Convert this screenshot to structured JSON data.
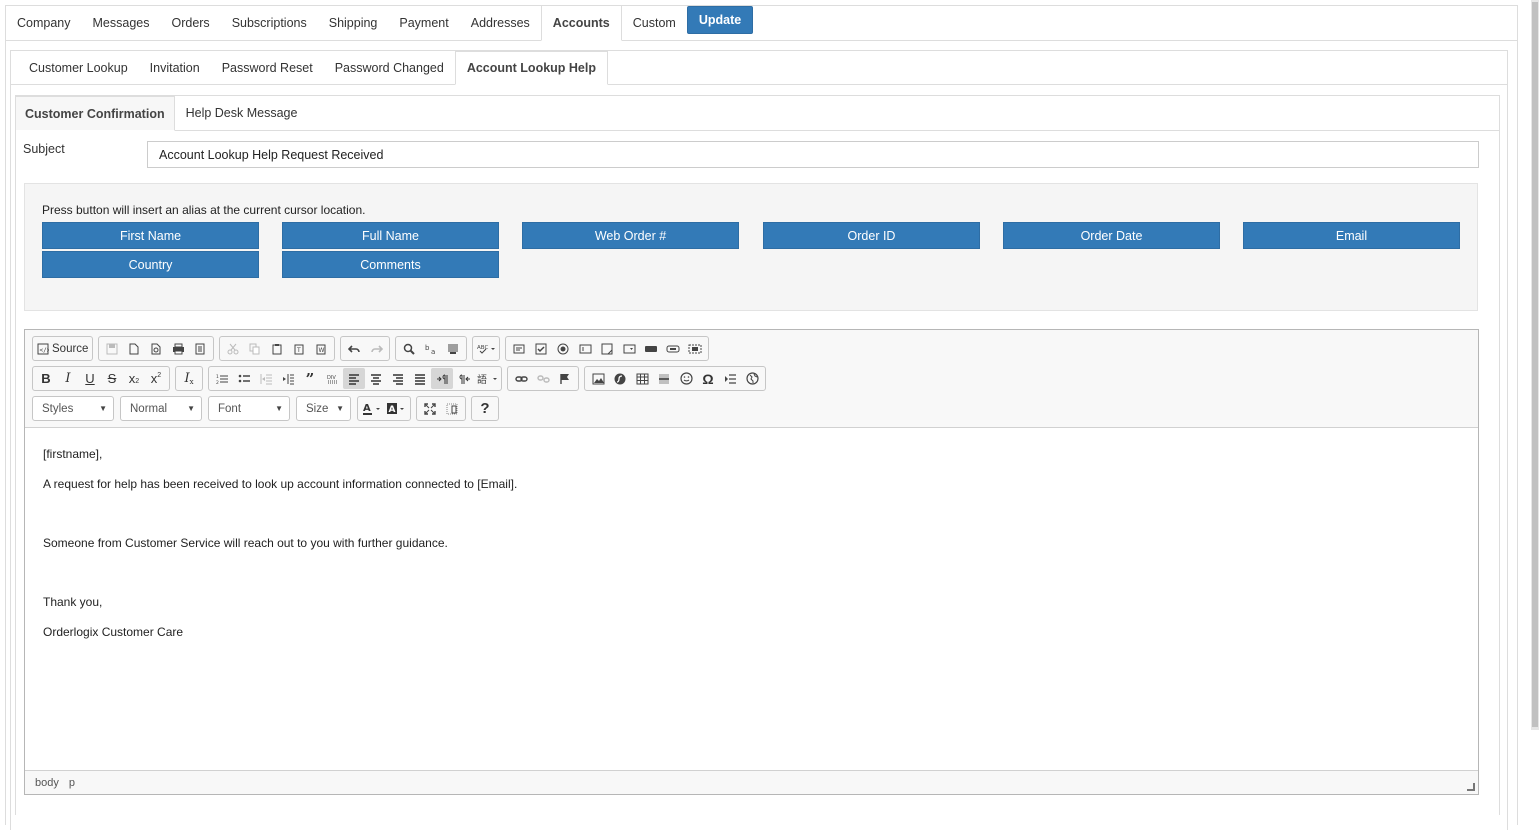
{
  "main_tabs": [
    "Company",
    "Messages",
    "Orders",
    "Subscriptions",
    "Shipping",
    "Payment",
    "Addresses",
    "Accounts",
    "Custom"
  ],
  "main_active": "Accounts",
  "update_label": "Update",
  "sub_tabs": [
    "Customer Lookup",
    "Invitation",
    "Password Reset",
    "Password Changed",
    "Account Lookup Help"
  ],
  "sub_active": "Account Lookup Help",
  "inner_tabs": [
    "Customer Confirmation",
    "Help Desk Message"
  ],
  "inner_active": "Customer Confirmation",
  "subject": {
    "label": "Subject",
    "value": "Account Lookup Help Request Received"
  },
  "alias": {
    "note": "Press button will insert an alias at the current cursor location.",
    "buttons": [
      "First Name",
      "Full Name",
      "Web Order #",
      "Order ID",
      "Order Date",
      "Email",
      "Country",
      "Comments"
    ]
  },
  "toolbar": {
    "source_label": "Source",
    "styles": "Styles",
    "format": "Normal",
    "font": "Font",
    "size": "Size"
  },
  "body_lines": [
    "[firstname],",
    "A request for help has been received to look up account information connected to [Email].",
    "Someone from Customer Service will reach out to you with further guidance.",
    "Thank you,",
    "Orderlogix Customer Care"
  ],
  "status_path": [
    "body",
    "p"
  ],
  "colors": {
    "primary": "#337ab7"
  }
}
